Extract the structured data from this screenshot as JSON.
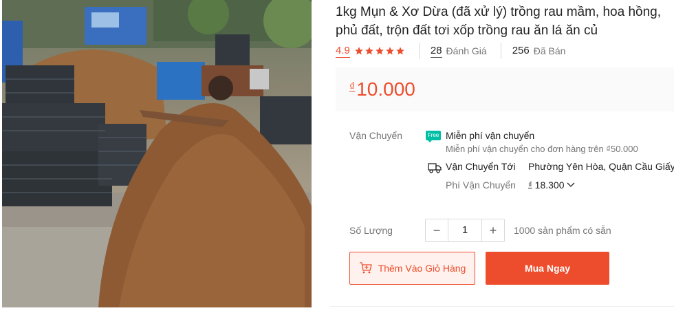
{
  "product": {
    "title_line1": "1kg Mụn & Xơ Dừa (đã xử lý) trồng rau mầm, hoa hồng,",
    "title_line2": "phủ đất, trộn đất tơi xốp trồng rau ăn lá ăn củ",
    "image_alt_icon": "product-photo-coco-coir"
  },
  "rating": {
    "score": "4.9",
    "stars": 5,
    "reviews_count": "28",
    "reviews_label": "Đánh Giá",
    "sold_count": "256",
    "sold_label": "Đã Bán"
  },
  "price": {
    "currency": "₫",
    "value": "10.000"
  },
  "shipping": {
    "label": "Vận Chuyển",
    "free_badge": "Free",
    "free_title": "Miễn phí vận chuyển",
    "free_sub": "Miễn phí vận chuyển cho đơn hàng trên ₫50.000",
    "to_label": "Vận Chuyển Tới",
    "to_value": "Phường Yên Hòa, Quận Cầu Giấy",
    "fee_label": "Phí Vận Chuyển",
    "fee_currency": "₫",
    "fee_value": "18.300"
  },
  "quantity": {
    "label": "Số Lượng",
    "value": "1",
    "minus": "−",
    "plus": "+",
    "stock": "1000 sản phẩm có sẵn"
  },
  "actions": {
    "add_to_cart": "Thêm Vào Giỏ Hàng",
    "buy_now": "Mua Ngay"
  },
  "colors": {
    "accent": "#ee4d2d",
    "free_ship": "#00bfa5"
  }
}
